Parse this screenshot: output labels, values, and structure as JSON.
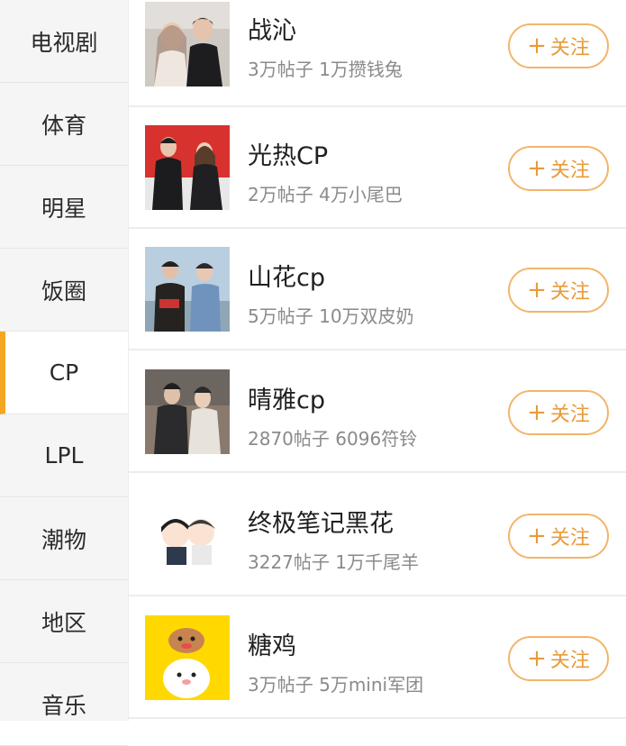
{
  "sidebar": {
    "items": [
      {
        "label": "电视剧"
      },
      {
        "label": "体育"
      },
      {
        "label": "明星"
      },
      {
        "label": "饭圈"
      },
      {
        "label": "CP",
        "active": true
      },
      {
        "label": "LPL"
      },
      {
        "label": "潮物"
      },
      {
        "label": "地区"
      },
      {
        "label": "音乐"
      }
    ],
    "accent_color": "#f5a623"
  },
  "follow_label": "关注",
  "follow_icon": "plus-icon",
  "list": [
    {
      "name": "战沁",
      "posts": "3万帖子",
      "fans": "1万攒钱兔",
      "thumb": "couple-photo"
    },
    {
      "name": "光热CP",
      "posts": "2万帖子",
      "fans": "4万小尾巴",
      "thumb": "couple-photo-red"
    },
    {
      "name": "山花cp",
      "posts": "5万帖子",
      "fans": "10万双皮奶",
      "thumb": "couple-photo-outdoor"
    },
    {
      "name": "晴雅cp",
      "posts": "2870帖子",
      "fans": "6096符铃",
      "thumb": "couple-photo-costume"
    },
    {
      "name": "终极笔记黑花",
      "posts": "3227帖子",
      "fans": "1万千尾羊",
      "thumb": "cartoon-couple"
    },
    {
      "name": "糖鸡",
      "posts": "3万帖子",
      "fans": "5万mini军团",
      "thumb": "cartoon-characters-yellow"
    }
  ],
  "colors": {
    "follow": "#e89b3a",
    "follow_border": "#f2b56b",
    "meta": "#8a8a8a"
  }
}
